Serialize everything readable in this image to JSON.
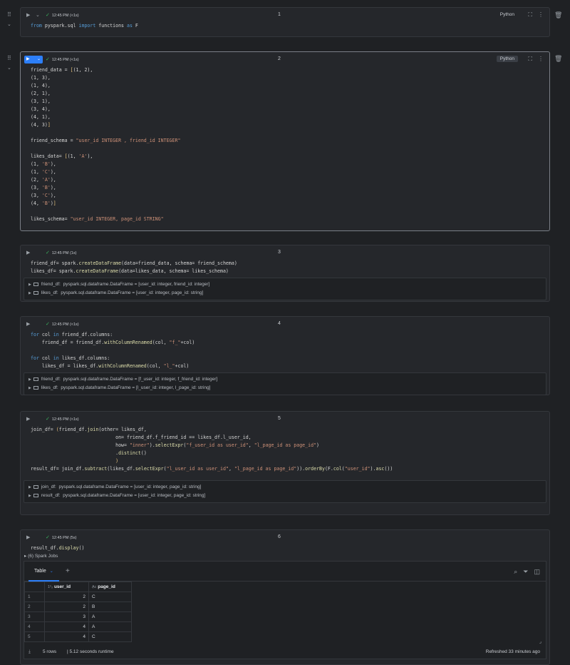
{
  "cells": [
    {
      "number": "1",
      "status": "12:45 PM (<1s)",
      "language": "Python"
    },
    {
      "number": "2",
      "status": "12:45 PM (<1s)",
      "language": "Python"
    },
    {
      "number": "3",
      "status": "12:45 PM (1s)"
    },
    {
      "number": "4",
      "status": "12:45 PM (<1s)"
    },
    {
      "number": "5",
      "status": "12:45 PM (<1s)"
    },
    {
      "number": "6",
      "status": "12:45 PM (5s)"
    }
  ],
  "outputs": {
    "cell3": [
      {
        "name": "friend_df:",
        "type": "pyspark.sql.dataframe.DataFrame = [user_id: integer, friend_id: integer]"
      },
      {
        "name": "likes_df:",
        "type": "pyspark.sql.dataframe.DataFrame = [user_id: integer, page_id: string]"
      }
    ],
    "cell4": [
      {
        "name": "friend_df:",
        "type": "pyspark.sql.dataframe.DataFrame = [f_user_id: integer, f_friend_id: integer]"
      },
      {
        "name": "likes_df:",
        "type": "pyspark.sql.dataframe.DataFrame = [l_user_id: integer, l_page_id: string]"
      }
    ],
    "cell5": [
      {
        "name": "join_df:",
        "type": "pyspark.sql.dataframe.DataFrame = [user_id: integer, page_id: string]"
      },
      {
        "name": "result_df:",
        "type": "pyspark.sql.dataframe.DataFrame = [user_id: integer, page_id: string]"
      }
    ]
  },
  "spark_jobs": "(6) Spark Jobs",
  "result_table": {
    "tab_label": "Table",
    "columns": [
      "user_id",
      "page_id"
    ],
    "col_type_icons": [
      "1²₃",
      "A᷊c"
    ],
    "rows": [
      {
        "idx": "1",
        "user_id": "2",
        "page_id": "C"
      },
      {
        "idx": "2",
        "user_id": "2",
        "page_id": "B"
      },
      {
        "idx": "3",
        "user_id": "3",
        "page_id": "A"
      },
      {
        "idx": "4",
        "user_id": "4",
        "page_id": "A"
      },
      {
        "idx": "5",
        "user_id": "4",
        "page_id": "C"
      }
    ],
    "footer_rows": "5 rows",
    "footer_runtime": "| 5.12 seconds runtime",
    "footer_refreshed": "Refreshed 33 minutes ago"
  }
}
